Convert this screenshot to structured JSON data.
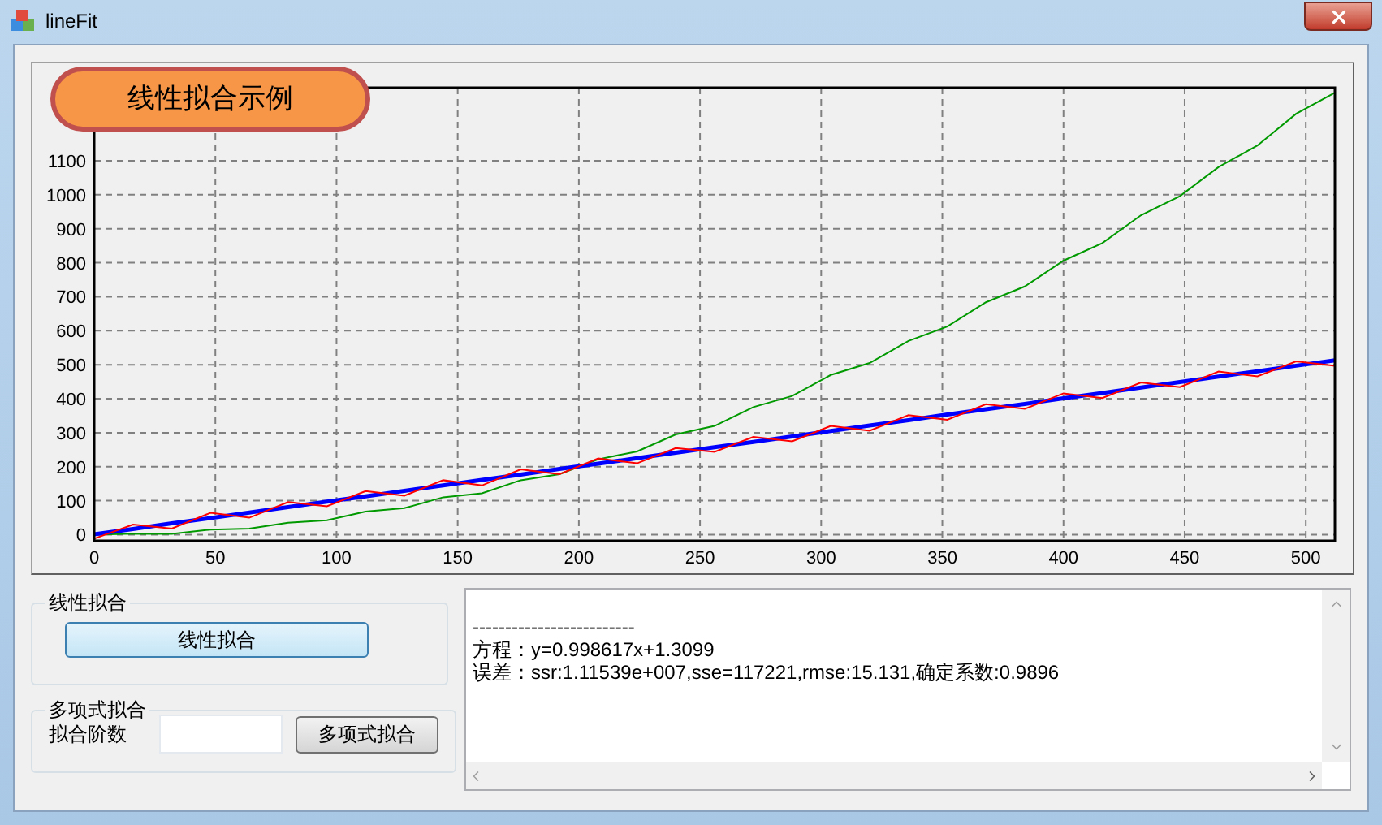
{
  "window": {
    "title": "lineFit"
  },
  "chart": {
    "badge": "线性拟合示例",
    "chart_data": {
      "type": "line",
      "x": [
        0,
        16,
        32,
        48,
        64,
        80,
        96,
        112,
        128,
        144,
        160,
        176,
        192,
        208,
        224,
        240,
        256,
        272,
        288,
        304,
        320,
        336,
        352,
        368,
        384,
        400,
        416,
        432,
        448,
        464,
        480,
        496,
        512
      ],
      "series": [
        {
          "color": "#009900",
          "values": [
            0,
            3,
            2,
            15,
            18,
            35,
            42,
            68,
            78,
            110,
            122,
            160,
            178,
            222,
            245,
            295,
            320,
            375,
            408,
            470,
            505,
            570,
            612,
            684,
            730,
            806,
            858,
            940,
            996,
            1082,
            1145,
            1238,
            1300
          ]
        },
        {
          "color": "#0000ff",
          "values": [
            1,
            17,
            33,
            49,
            65,
            81,
            97,
            113,
            129,
            145,
            161,
            177,
            193,
            209,
            225,
            241,
            257,
            273,
            289,
            305,
            321,
            337,
            353,
            369,
            385,
            401,
            417,
            433,
            449,
            465,
            481,
            497,
            513
          ]
        },
        {
          "color": "#ff0000",
          "values": [
            -12,
            30,
            18,
            64,
            50,
            96,
            84,
            128,
            115,
            160,
            145,
            192,
            178,
            224,
            210,
            255,
            244,
            288,
            275,
            320,
            306,
            352,
            338,
            384,
            370,
            416,
            402,
            448,
            434,
            480,
            466,
            510,
            497
          ]
        }
      ],
      "grid": true,
      "xlim": [
        0,
        512
      ],
      "ylim": [
        -18,
        1315
      ],
      "xticks": [
        0,
        50,
        100,
        150,
        200,
        250,
        300,
        350,
        400,
        450,
        500
      ],
      "yticks": [
        0,
        100,
        200,
        300,
        400,
        500,
        600,
        700,
        800,
        900,
        1000,
        1100
      ]
    }
  },
  "linear_group": {
    "title": "线性拟合",
    "button": "线性拟合"
  },
  "poly_group": {
    "title": "多项式拟合",
    "order_label": "拟合阶数",
    "button": "多项式拟合"
  },
  "output": {
    "lines": [
      "-------------------------",
      "方程：y=0.998617x+1.3099",
      "误差：ssr:1.11539e+007,sse=117221,rmse:15.131,确定系数:0.9896"
    ]
  }
}
